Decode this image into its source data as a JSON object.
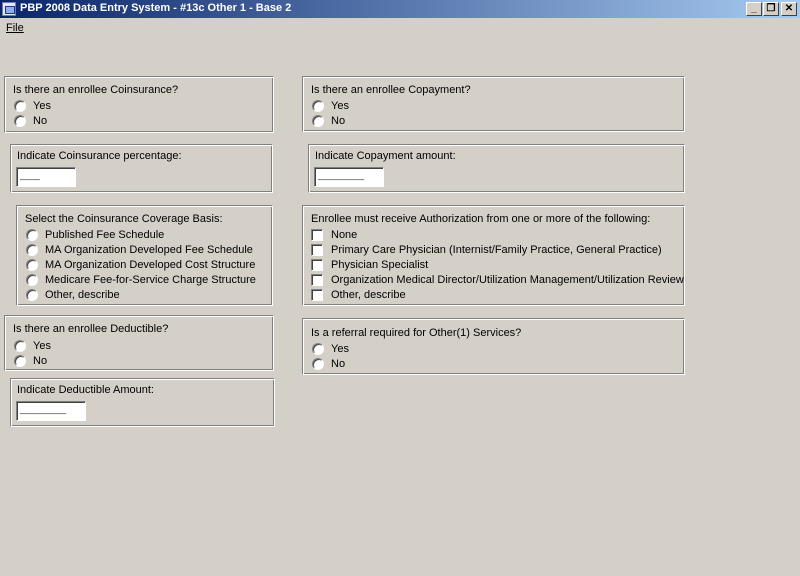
{
  "window": {
    "title": "PBP 2008 Data Entry System - #13c Other 1 - Base 2",
    "min_glyph": "_",
    "restore_glyph": "❐",
    "close_glyph": "✕"
  },
  "menu": {
    "file_label": "File"
  },
  "coinsurance": {
    "question": "Is there an enrollee Coinsurance?",
    "yes": "Yes",
    "no": "No"
  },
  "coinsurance_pct": {
    "label": "Indicate Coinsurance percentage:",
    "value": "___"
  },
  "coverage_basis": {
    "label": "Select the Coinsurance Coverage Basis:",
    "options": [
      "Published Fee Schedule",
      "MA Organization Developed Fee Schedule",
      "MA Organization Developed Cost Structure",
      "Medicare Fee-for-Service Charge Structure",
      "Other, describe"
    ]
  },
  "deductible": {
    "question": "Is there an enrollee Deductible?",
    "yes": "Yes",
    "no": "No"
  },
  "deductible_amount": {
    "label": "Indicate Deductible Amount:",
    "value": "_______"
  },
  "copayment": {
    "question": "Is there an enrollee Copayment?",
    "yes": "Yes",
    "no": "No"
  },
  "copayment_amount": {
    "label": "Indicate Copayment amount:",
    "value": "_______"
  },
  "authorization": {
    "label": "Enrollee must receive Authorization from one or more of the following:",
    "options": [
      "None",
      "Primary Care Physician (Internist/Family Practice, General Practice)",
      "Physician Specialist",
      "Organization Medical Director/Utilization Management/Utilization Review",
      "Other, describe"
    ]
  },
  "referral": {
    "question": "Is a referral required for Other(1) Services?",
    "yes": "Yes",
    "no": "No"
  }
}
